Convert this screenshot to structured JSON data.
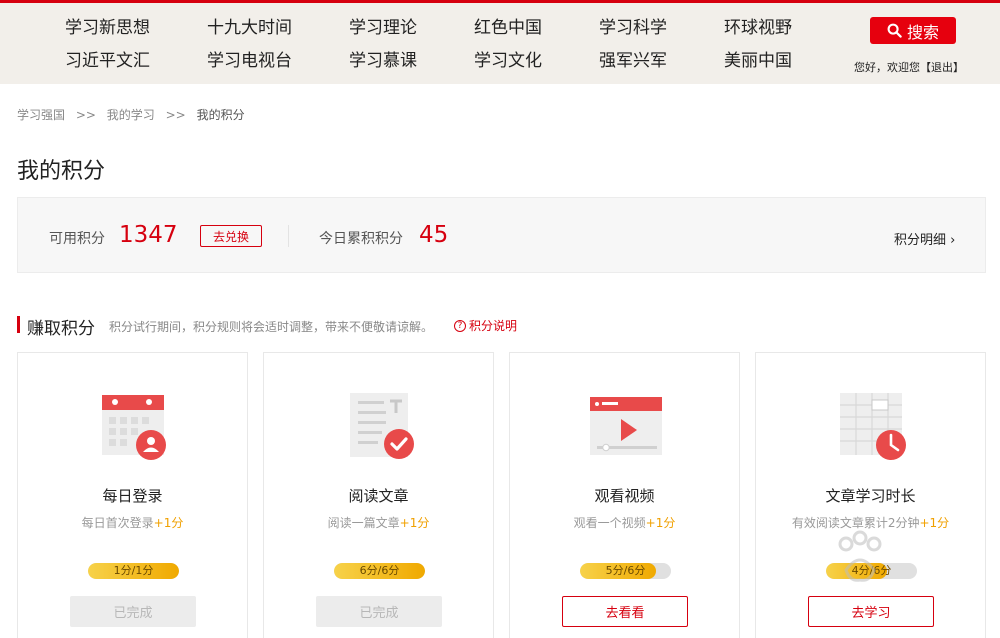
{
  "nav": {
    "items": [
      "学习新思想",
      "十九大时间",
      "学习理论",
      "红色中国",
      "学习科学",
      "环球视野",
      "习近平文汇",
      "学习电视台",
      "学习慕课",
      "学习文化",
      "强军兴军",
      "美丽中国"
    ]
  },
  "search": {
    "label": "搜索",
    "icon": "search-icon"
  },
  "user": {
    "greeting": "您好，欢迎您",
    "logout": "【退出】"
  },
  "breadcrumb": {
    "items": [
      "学习强国",
      "我的学习",
      "我的积分"
    ],
    "separator": ">>"
  },
  "page_title": "我的积分",
  "score": {
    "available_label": "可用积分",
    "available_value": "1347",
    "exchange_label": "去兑换",
    "today_label": "今日累积积分",
    "today_value": "45",
    "detail_label": "积分明细 ›"
  },
  "earn": {
    "title": "赚取积分",
    "note": "积分试行期间，积分规则将会适时调整，带来不便敬请谅解。",
    "help_label": "积分说明",
    "help_icon": "?"
  },
  "cards": [
    {
      "title": "每日登录",
      "desc": "每日首次登录",
      "bonus": "+1分",
      "progress_text": "1分/1分",
      "progress": 1.0,
      "button": "已完成",
      "done": true,
      "icon": "calendar-user-icon"
    },
    {
      "title": "阅读文章",
      "desc": "阅读一篇文章",
      "bonus": "+1分",
      "progress_text": "6分/6分",
      "progress": 1.0,
      "button": "已完成",
      "done": true,
      "icon": "article-check-icon"
    },
    {
      "title": "观看视频",
      "desc": "观看一个视频",
      "bonus": "+1分",
      "progress_text": "5分/6分",
      "progress": 0.83,
      "button": "去看看",
      "done": false,
      "icon": "video-play-icon"
    },
    {
      "title": "文章学习时长",
      "desc": "有效阅读文章累计2分钟",
      "bonus": "+1分",
      "progress_text": "4分/6分",
      "progress": 0.67,
      "button": "去学习",
      "done": false,
      "icon": "clock-grid-icon"
    }
  ],
  "colors": {
    "accent": "#d6000f",
    "progress": "#f0a900",
    "bonus": "#f0a000"
  }
}
